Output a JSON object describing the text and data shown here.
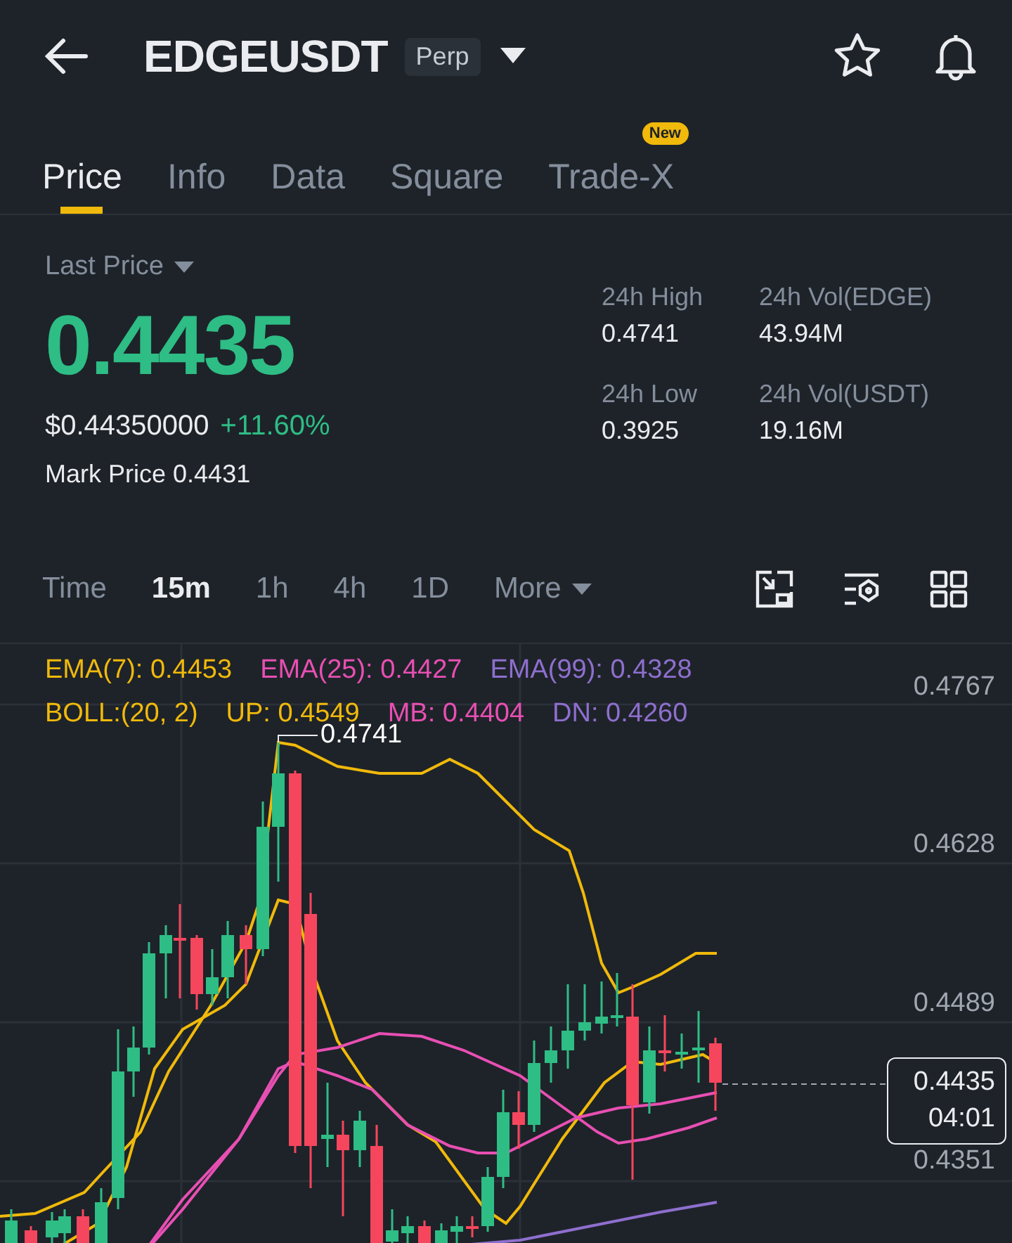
{
  "header": {
    "symbol": "EDGEUSDT",
    "contract_badge": "Perp"
  },
  "tabs": [
    {
      "label": "Price",
      "selected": true
    },
    {
      "label": "Info",
      "selected": false
    },
    {
      "label": "Data",
      "selected": false
    },
    {
      "label": "Square",
      "selected": false
    },
    {
      "label": "Trade-X",
      "selected": false,
      "badge": "New"
    }
  ],
  "price": {
    "label": "Last Price",
    "last": "0.4435",
    "usd": "$0.44350000",
    "change": "+11.60%",
    "mark_label": "Mark Price",
    "mark": "0.4431"
  },
  "stats": [
    {
      "label": "24h High",
      "value": "0.4741"
    },
    {
      "label": "24h Vol(EDGE)",
      "value": "43.94M"
    },
    {
      "label": "24h Low",
      "value": "0.3925"
    },
    {
      "label": "24h Vol(USDT)",
      "value": "19.16M"
    }
  ],
  "intervals": [
    {
      "label": "Time",
      "kind": "interval",
      "selected": false
    },
    {
      "label": "15m",
      "kind": "interval",
      "selected": true
    },
    {
      "label": "1h",
      "kind": "interval",
      "selected": false
    },
    {
      "label": "4h",
      "kind": "interval",
      "selected": false
    },
    {
      "label": "1D",
      "kind": "interval",
      "selected": false
    },
    {
      "label": "More",
      "kind": "menu",
      "selected": false
    }
  ],
  "chart": {
    "indicator_rows": [
      [
        {
          "text": "EMA(7): 0.4453",
          "color": "#f0b90b"
        },
        {
          "text": "EMA(25): 0.4427",
          "color": "#e84fb3"
        },
        {
          "text": "EMA(99): 0.4328",
          "color": "#8e6fce"
        }
      ],
      [
        {
          "text": "BOLL:(20, 2)",
          "color": "#f0b90b"
        },
        {
          "text": "UP: 0.4549",
          "color": "#f0b90b"
        },
        {
          "text": "MB: 0.4404",
          "color": "#e84fb3"
        },
        {
          "text": "DN: 0.4260",
          "color": "#8e6fce"
        }
      ]
    ],
    "price_axis": [
      "0.4767",
      "0.4628",
      "0.4489",
      "0.4351"
    ],
    "high_marker": "0.4741",
    "current_price": "0.4435",
    "countdown": "04:01"
  }
}
